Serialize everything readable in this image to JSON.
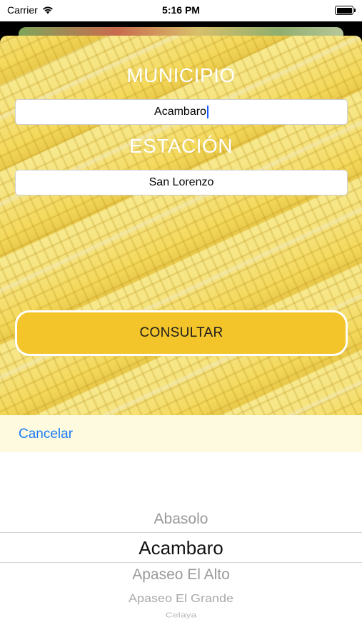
{
  "status_bar": {
    "carrier": "Carrier",
    "time": "5:16 PM"
  },
  "form": {
    "municipio_label": "MUNICIPIO",
    "municipio_value": "Acambaro",
    "estacion_label": "ESTACIÓN",
    "estacion_value": "San Lorenzo",
    "consultar_label": "CONSULTAR"
  },
  "picker": {
    "cancel_label": "Cancelar",
    "options": [
      "Abasolo",
      "Acambaro",
      "Apaseo El Alto",
      "Apaseo El Grande",
      "Celaya"
    ],
    "selected": "Acambaro"
  },
  "colors": {
    "accent_button": "#f3c52b",
    "link_blue": "#1a7cf5",
    "toolbar_bg": "#fefae0"
  }
}
